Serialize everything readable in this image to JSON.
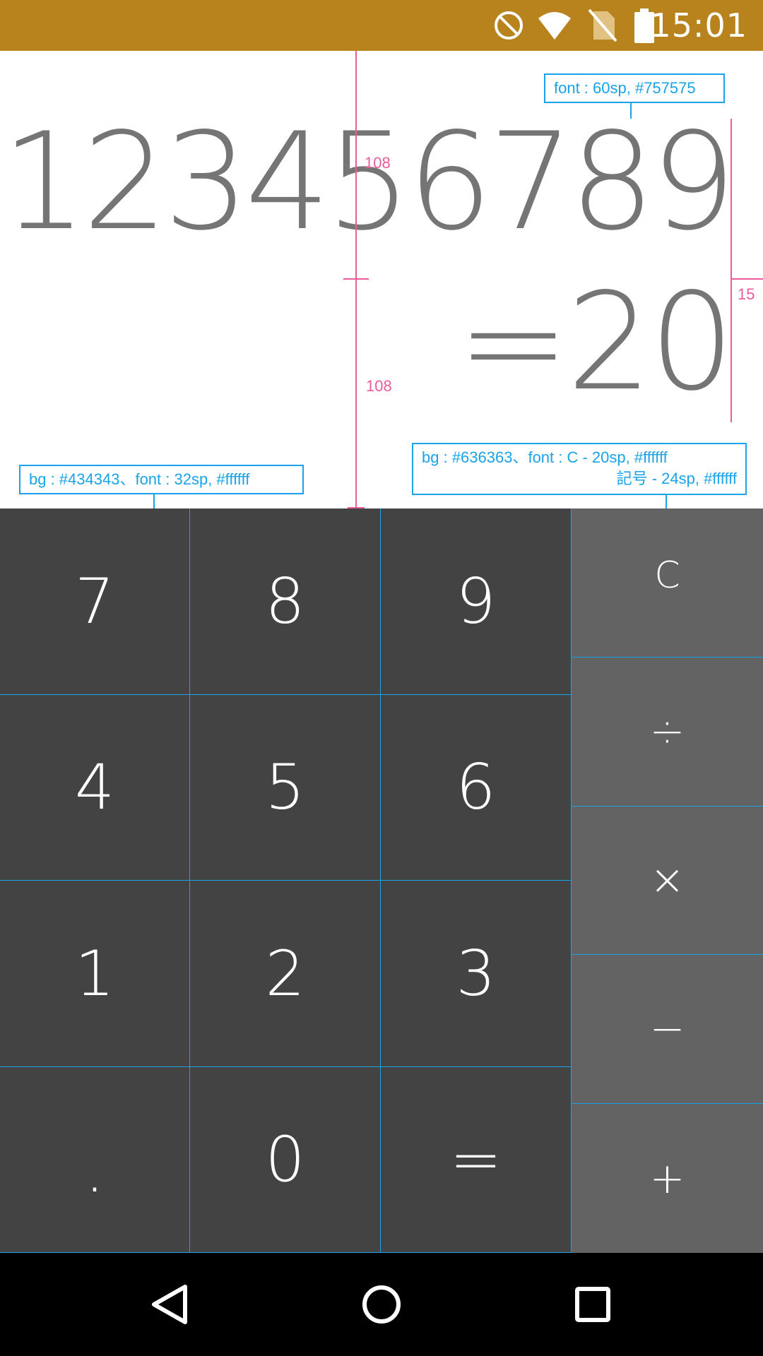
{
  "status_bar": {
    "time": "15:01",
    "icons": [
      "do-not-disturb-icon",
      "wifi-icon",
      "no-sim-icon",
      "battery-icon"
    ],
    "background": "#b8821c"
  },
  "display": {
    "expression": "123456789",
    "result": "=20",
    "color": "#757575"
  },
  "annotations": {
    "display_font": "font : 60sp, #757575",
    "measure_top": "108",
    "measure_bottom": "108",
    "measure_right": "15",
    "keypad_number": "bg : #434343、font : 32sp, #ffffff",
    "keypad_operator_line1": "bg : #636363、font : C - 20sp, #ffffff",
    "keypad_operator_line2": "記号 - 24sp, #ffffff"
  },
  "keypad": {
    "number_bg": "#434343",
    "operator_bg": "#636363",
    "keys": [
      "7",
      "8",
      "9",
      "4",
      "5",
      "6",
      "1",
      "2",
      "3",
      ".",
      "0",
      "="
    ],
    "operators": [
      "C",
      "÷",
      "×",
      "−",
      "+"
    ]
  },
  "nav_bar": {
    "buttons": [
      "back-icon",
      "home-icon",
      "recents-icon"
    ]
  }
}
